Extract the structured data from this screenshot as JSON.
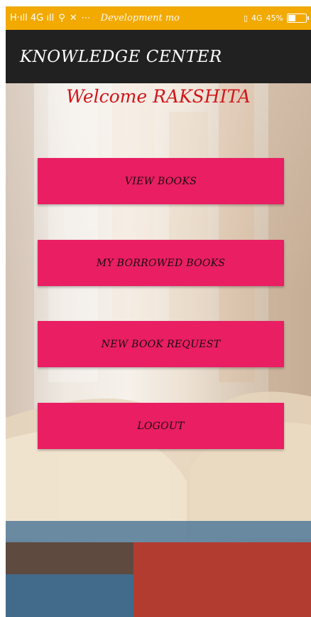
{
  "status_bar": {
    "left_text": "H·ıll 4G ıll",
    "mode_text": "Development mo",
    "network_text": "4G",
    "battery_text": "45%",
    "battery_level": 0.45,
    "color": "#f2a900"
  },
  "app_bar": {
    "title": "KNOWLEDGE CENTER",
    "color": "#212121"
  },
  "main": {
    "welcome_text": "Welcome RAKSHITA",
    "welcome_color": "#d0161b",
    "button_color": "#e91e63",
    "buttons": [
      {
        "label": "VIEW BOOKS"
      },
      {
        "label": "MY BORROWED BOOKS"
      },
      {
        "label": "NEW BOOK REQUEST"
      },
      {
        "label": "LOGOUT"
      }
    ]
  }
}
